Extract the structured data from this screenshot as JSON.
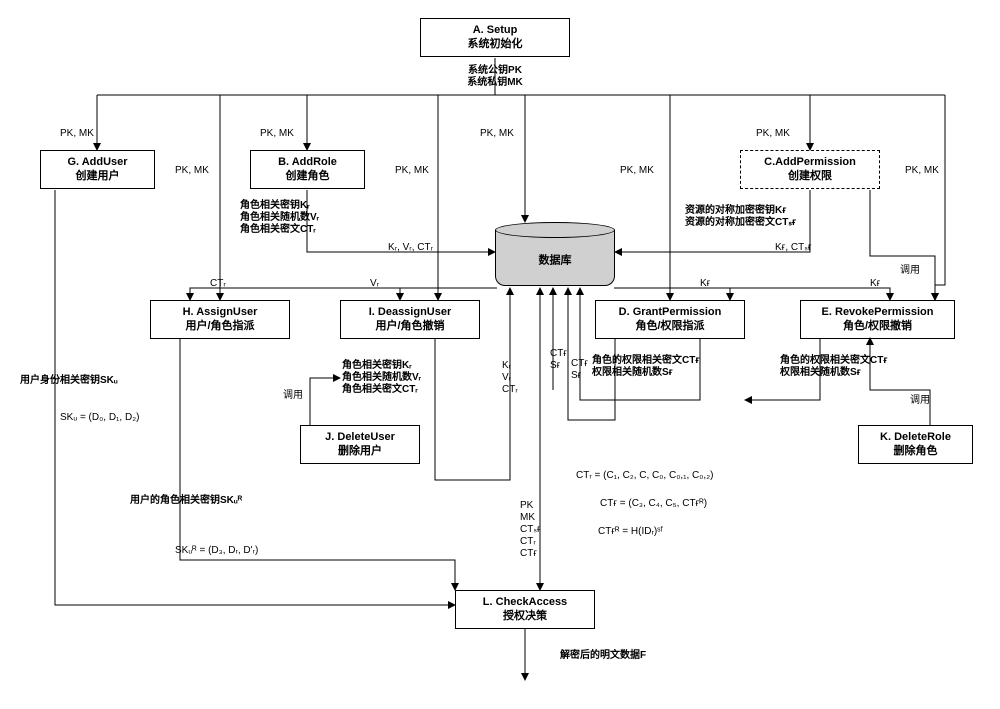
{
  "boxes": {
    "A": {
      "t": "A. Setup",
      "s": "系统初始化"
    },
    "B": {
      "t": "B. AddRole",
      "s": "创建角色"
    },
    "C": {
      "t": "C.AddPermission",
      "s": "创建权限"
    },
    "D": {
      "t": "D. GrantPermission",
      "s": "角色/权限指派"
    },
    "E": {
      "t": "E. RevokePermission",
      "s": "角色/权限撤销"
    },
    "G": {
      "t": "G. AddUser",
      "s": "创建用户"
    },
    "H": {
      "t": "H. AssignUser",
      "s": "用户/角色指派"
    },
    "I": {
      "t": "I. DeassignUser",
      "s": "用户/角色撤销"
    },
    "J": {
      "t": "J. DeleteUser",
      "s": "删除用户"
    },
    "K": {
      "t": "K. DeleteRole",
      "s": "删除角色"
    },
    "L": {
      "t": "L. CheckAccess",
      "s": "授权决策"
    }
  },
  "db": "数据库",
  "labels": {
    "a_out": "系统公钥PK\n系统私钥MK",
    "pkmk": "PK, MK",
    "b_out": "角色相关密钥Kᵣ\n角色相关随机数Vᵣ\n角色相关密文CTᵣ",
    "b_db": "Kᵣ, Vᵣ, CTᵣ",
    "c_out": "资源的对称加密密钥Kғ\n资源的对称加密密文CTₛғ",
    "c_db": "Kғ, CTₛғ",
    "db_h": "CTᵣ",
    "db_i": "Vᵣ",
    "db_d": "Kғ",
    "db_e": "Kғ",
    "e_call": "调用",
    "i_call": "调用",
    "k_call": "调用",
    "d_out": "角色的权限相关密文CTғ\n权限相关随机数Sғ",
    "e_out": "角色的权限相关密文CTғ\n权限相关随机数Sғ",
    "i_out": "角色相关密钥Kᵣ\n角色相关随机数Vᵣ\n角色相关密文CTᵣ",
    "g_out": "用户身份相关密钥SKᵤ",
    "skU": "SKᵤ = (D₀, D₁, D₂)",
    "h_out": "用户的角色相关密钥SKᵤᴿ",
    "skR": "SKᵤᴿ = (D₃, Dᵣ, D'ᵣ)",
    "db_l": "PK\nMK\nCTₛғ\nCTᵣ\nCTғ",
    "l_out": "解密后的明文数据F",
    "ctR": "CTᵣ = (C₁, C₂, C, C₀, C₀,₁, C₀,₂)",
    "ctF": "CTғ = (C₃, C₄, C₅, CTғᴿ)",
    "ctFR": "CTғᴿ = H(IDᵣ)ˢᶠ",
    "d_db": "CTғ\nSғ",
    "d_db2": "CTғ\nSғ",
    "i_db": "Kᵣ\nVᵣ\nCTᵣ"
  }
}
